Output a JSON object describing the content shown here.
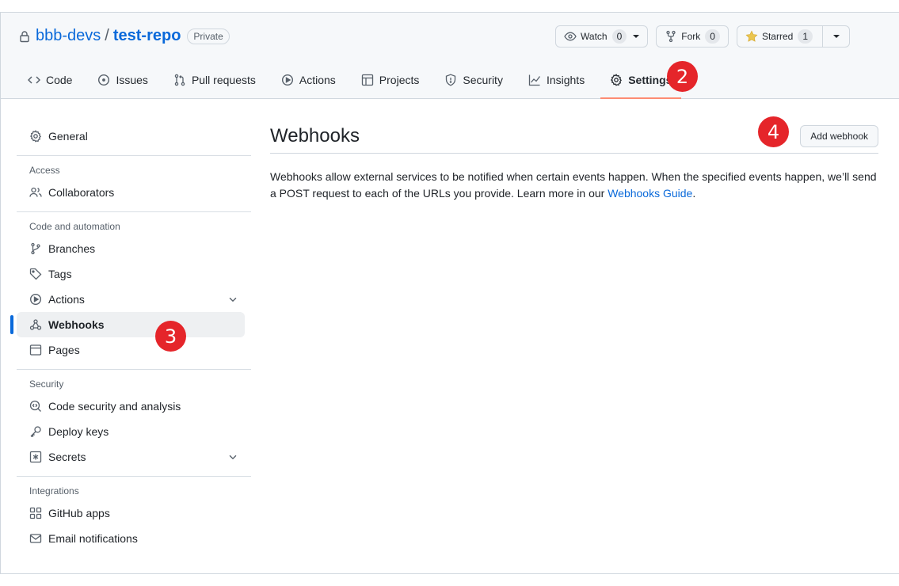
{
  "repo": {
    "owner": "bbb-devs",
    "separator": "/",
    "name": "test-repo",
    "visibility": "Private"
  },
  "header_actions": {
    "watch_label": "Watch",
    "watch_count": "0",
    "fork_label": "Fork",
    "fork_count": "0",
    "starred_label": "Starred",
    "starred_count": "1"
  },
  "tabs": [
    {
      "label": "Code",
      "icon": "code-icon"
    },
    {
      "label": "Issues",
      "icon": "issue-icon"
    },
    {
      "label": "Pull requests",
      "icon": "pull-request-icon"
    },
    {
      "label": "Actions",
      "icon": "play-icon"
    },
    {
      "label": "Projects",
      "icon": "table-icon"
    },
    {
      "label": "Security",
      "icon": "shield-icon"
    },
    {
      "label": "Insights",
      "icon": "graph-icon"
    },
    {
      "label": "Settings",
      "icon": "gear-icon",
      "active": true
    }
  ],
  "markers": {
    "settings": "2",
    "webhooks": "3",
    "add_webhook": "4"
  },
  "sidebar": {
    "general": "General",
    "access_heading": "Access",
    "collaborators": "Collaborators",
    "code_heading": "Code and automation",
    "branches": "Branches",
    "tags": "Tags",
    "actions": "Actions",
    "webhooks": "Webhooks",
    "pages": "Pages",
    "security_heading": "Security",
    "code_security": "Code security and analysis",
    "deploy_keys": "Deploy keys",
    "secrets": "Secrets",
    "integrations_heading": "Integrations",
    "github_apps": "GitHub apps",
    "email_notifications": "Email notifications"
  },
  "main": {
    "title": "Webhooks",
    "add_button": "Add webhook",
    "description": "Webhooks allow external services to be notified when certain events happen. When the specified events happen, we’ll send a POST request to each of the URLs you provide. Learn more in our ",
    "guide_link": "Webhooks Guide",
    "description_end": "."
  },
  "colors": {
    "accent": "#0969da",
    "tab_underline": "#fd8c73",
    "marker": "#e5252a",
    "star": "#eac54f"
  }
}
